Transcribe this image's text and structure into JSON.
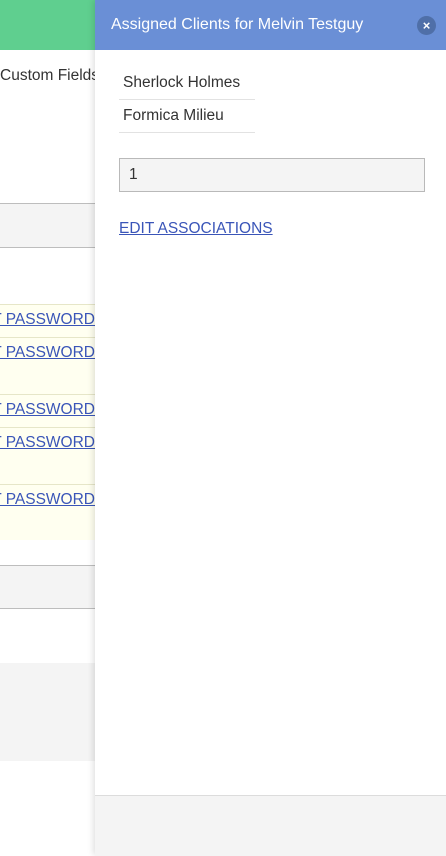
{
  "background": {
    "nav_partial_label": "Custom Fields",
    "reset_links": [
      "RESET PASSWORD",
      "RESET PASSWORD",
      "RESET PASSWORD",
      "RESET PASSWORD",
      "RESET PASSWORD"
    ]
  },
  "panel": {
    "title": "Assigned Clients for Melvin Testguy",
    "close_symbol": "×",
    "clients": [
      "Sherlock Holmes",
      "Formica Milieu"
    ],
    "count_value": "1",
    "edit_link": "EDIT ASSOCIATIONS"
  },
  "colors": {
    "header": "#6a8fd6",
    "topbar": "#5fcf8f",
    "link": "#3a55b8",
    "highlight_row": "#fffff0"
  }
}
